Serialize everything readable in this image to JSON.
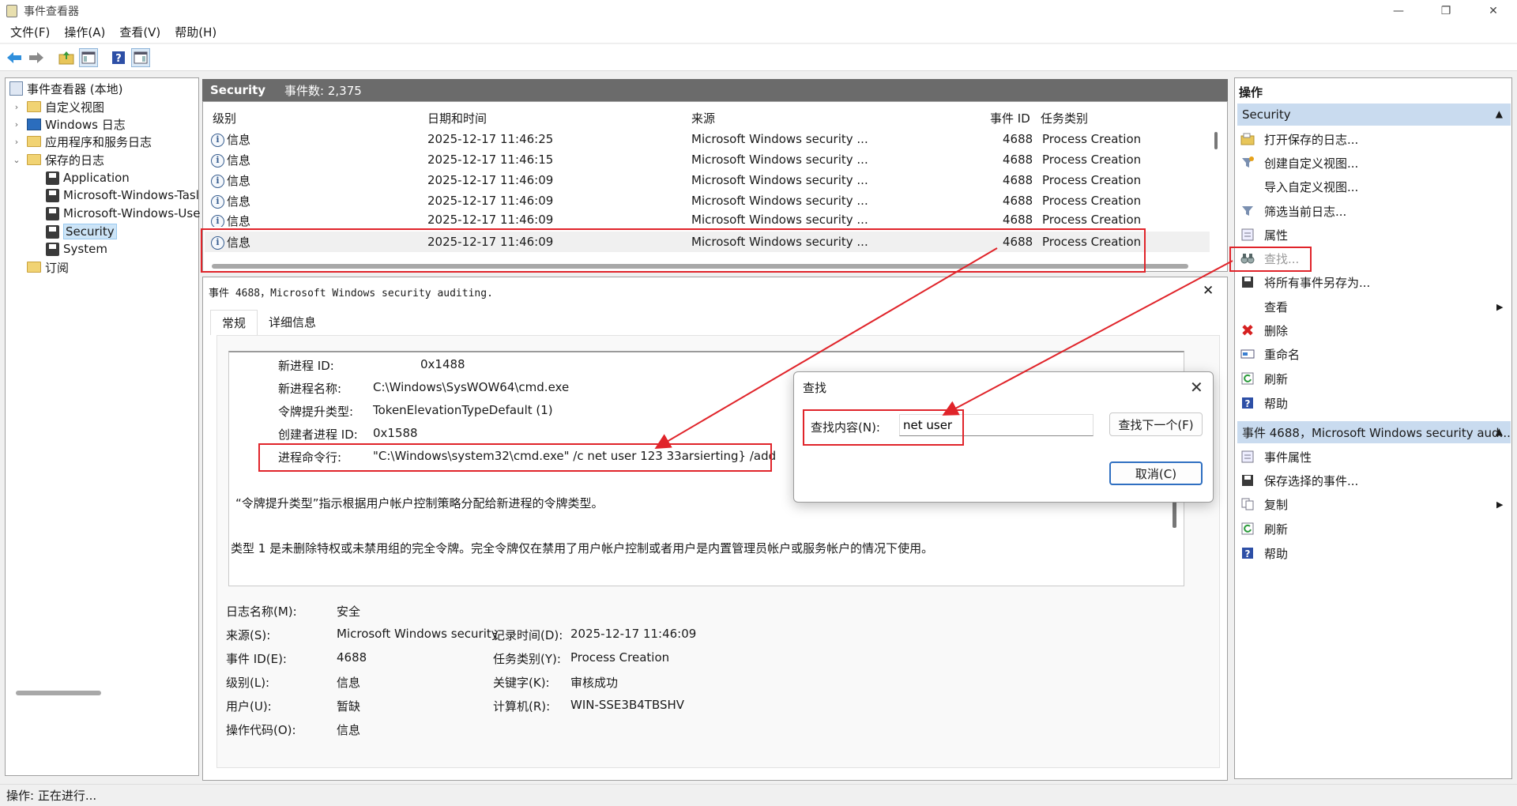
{
  "window": {
    "title": "事件查看器"
  },
  "menu": [
    "文件(F)",
    "操作(A)",
    "查看(V)",
    "帮助(H)"
  ],
  "tree": {
    "root": "事件查看器 (本地)",
    "items": [
      {
        "label": "自定义视图",
        "icon": "folder-icon"
      },
      {
        "label": "Windows 日志",
        "icon": "windows-log-icon"
      },
      {
        "label": "应用程序和服务日志",
        "icon": "folder-icon"
      },
      {
        "label": "保存的日志",
        "icon": "folder-icon"
      }
    ],
    "saved_logs": [
      "Application",
      "Microsoft-Windows-Tasl",
      "Microsoft-Windows-Use",
      "Security",
      "System"
    ],
    "subscriptions": "订阅"
  },
  "center": {
    "log_name": "Security",
    "event_count": "事件数: 2,375",
    "columns": [
      "级别",
      "日期和时间",
      "来源",
      "事件 ID",
      "任务类别"
    ],
    "rows": [
      {
        "level": "信息",
        "datetime": "2025-12-17 11:46:25",
        "source": "Microsoft Windows security ...",
        "event_id": "4688",
        "task": "Process Creation"
      },
      {
        "level": "信息",
        "datetime": "2025-12-17 11:46:15",
        "source": "Microsoft Windows security ...",
        "event_id": "4688",
        "task": "Process Creation"
      },
      {
        "level": "信息",
        "datetime": "2025-12-17 11:46:09",
        "source": "Microsoft Windows security ...",
        "event_id": "4688",
        "task": "Process Creation"
      },
      {
        "level": "信息",
        "datetime": "2025-12-17 11:46:09",
        "source": "Microsoft Windows security ...",
        "event_id": "4688",
        "task": "Process Creation"
      },
      {
        "level": "信息",
        "datetime": "2025-12-17 11:46:09",
        "source": "Microsoft Windows security ...",
        "event_id": "4688",
        "task": "Process Creation"
      },
      {
        "level": "信息",
        "datetime": "2025-12-17 11:46:09",
        "source": "Microsoft Windows security ...",
        "event_id": "4688",
        "task": "Process Creation"
      }
    ]
  },
  "detail": {
    "title": "事件 4688，Microsoft Windows security auditing.",
    "tabs": [
      "常规",
      "详细信息"
    ],
    "description": [
      {
        "k": "新进程 ID:",
        "v": "0x1488"
      },
      {
        "k": "新进程名称:",
        "v": "C:\\Windows\\SysWOW64\\cmd.exe"
      },
      {
        "k": "令牌提升类型:",
        "v": "TokenElevationTypeDefault (1)"
      },
      {
        "k": "创建者进程 ID:",
        "v": "0x1588"
      },
      {
        "k": "进程命令行:",
        "v": "\"C:\\Windows\\system32\\cmd.exe\" /c net user 123 33arsierting} /add"
      }
    ],
    "note1": "“令牌提升类型”指示根据用户帐户控制策略分配给新进程的令牌类型。",
    "note2": "类型 1 是未删除特权或未禁用组的完全令牌。完全令牌仅在禁用了用户帐户控制或者用户是内置管理员帐户或服务帐户的情况下使用。",
    "props": {
      "log_name_label": "日志名称(M):",
      "log_name": "安全",
      "source_label": "来源(S):",
      "source": "Microsoft Windows security",
      "logged_label": "记录时间(D):",
      "logged": "2025-12-17 11:46:09",
      "event_id_label": "事件 ID(E):",
      "event_id": "4688",
      "task_label": "任务类别(Y):",
      "task": "Process Creation",
      "level_label": "级别(L):",
      "level": "信息",
      "keywords_label": "关键字(K):",
      "keywords": "审核成功",
      "user_label": "用户(U):",
      "user": "暂缺",
      "computer_label": "计算机(R):",
      "computer": "WIN-SSE3B4TBSHV",
      "opcode_label": "操作代码(O):",
      "opcode": "信息"
    }
  },
  "actions": {
    "header": "操作",
    "section1": "Security",
    "items1": [
      {
        "label": "打开保存的日志...",
        "icon": "open-log-icon"
      },
      {
        "label": "创建自定义视图...",
        "icon": "filter-icon"
      },
      {
        "label": "导入自定义视图...",
        "icon": ""
      },
      {
        "label": "筛选当前日志...",
        "icon": "filter-icon"
      },
      {
        "label": "属性",
        "icon": "properties-icon"
      },
      {
        "label": "查找...",
        "icon": "binoculars-icon"
      },
      {
        "label": "将所有事件另存为...",
        "icon": "save-icon"
      },
      {
        "label": "查看",
        "icon": ""
      },
      {
        "label": "删除",
        "icon": "delete-icon"
      },
      {
        "label": "重命名",
        "icon": "rename-icon"
      },
      {
        "label": "刷新",
        "icon": "refresh-icon"
      },
      {
        "label": "帮助",
        "icon": "help-icon"
      }
    ],
    "section2": "事件 4688，Microsoft Windows security aud...",
    "items2": [
      {
        "label": "事件属性",
        "icon": "properties-icon"
      },
      {
        "label": "保存选择的事件...",
        "icon": "save-icon"
      },
      {
        "label": "复制",
        "icon": "copy-icon"
      },
      {
        "label": "刷新",
        "icon": "refresh-icon"
      },
      {
        "label": "帮助",
        "icon": "help-icon"
      }
    ]
  },
  "find_dialog": {
    "title": "查找",
    "label": "查找内容(N):",
    "value": "net user",
    "find_next": "查找下一个(F)",
    "cancel": "取消(C)"
  },
  "status": "操作: 正在进行...",
  "colors": {
    "highlight": "#e0242a",
    "section": "#c9dbef",
    "selection": "#cce4f7"
  }
}
